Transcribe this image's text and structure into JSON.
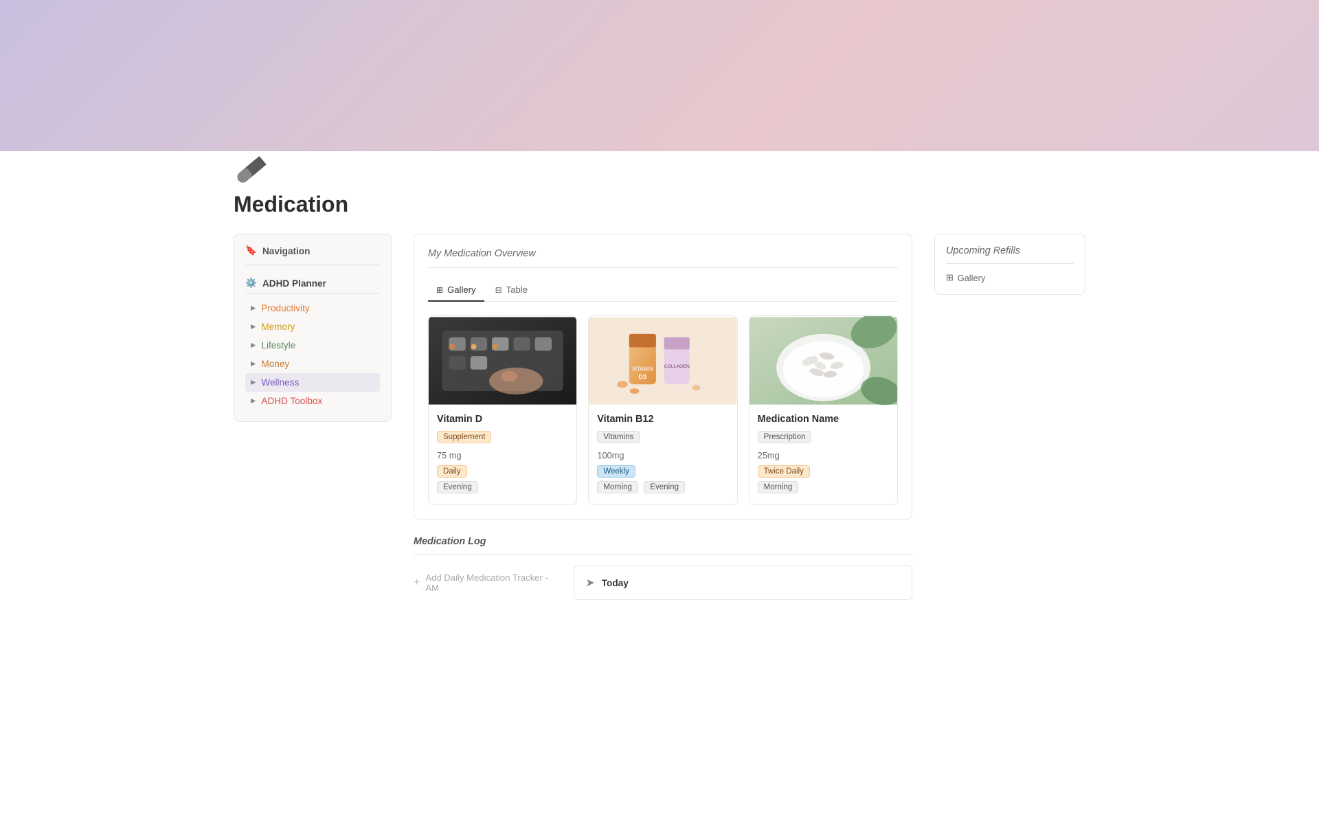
{
  "hero": {
    "alt": "Medication page hero banner"
  },
  "page": {
    "title": "Medication",
    "icon_alt": "pill icon"
  },
  "sidebar": {
    "header_label": "Navigation",
    "adhd_planner_label": "ADHD Planner",
    "items": [
      {
        "id": "productivity",
        "label": "Productivity",
        "color": "productivity",
        "active": false
      },
      {
        "id": "memory",
        "label": "Memory",
        "color": "memory",
        "active": false
      },
      {
        "id": "lifestyle",
        "label": "Lifestyle",
        "color": "lifestyle",
        "active": false
      },
      {
        "id": "money",
        "label": "Money",
        "color": "money",
        "active": false
      },
      {
        "id": "wellness",
        "label": "Wellness",
        "color": "wellness",
        "active": true
      },
      {
        "id": "adhd-toolbox",
        "label": "ADHD Toolbox",
        "color": "adhd-toolbox",
        "active": false
      }
    ]
  },
  "medication_overview": {
    "section_title": "My Medication Overview",
    "tabs": [
      {
        "id": "gallery",
        "label": "Gallery",
        "active": true
      },
      {
        "id": "table",
        "label": "Table",
        "active": false
      }
    ],
    "cards": [
      {
        "name": "Vitamin D",
        "tags": [
          "Supplement"
        ],
        "dosage": "75 mg",
        "schedule_tags": [
          "Daily"
        ],
        "time_tags": [
          "Evening"
        ],
        "image_type": "vitd"
      },
      {
        "name": "Vitamin B12",
        "tags": [
          "Vitamins"
        ],
        "dosage": "100mg",
        "schedule_tags": [
          "Weekly"
        ],
        "time_tags": [
          "Morning",
          "Evening"
        ],
        "image_type": "vitb12"
      },
      {
        "name": "Medication Name",
        "tags": [
          "Prescription"
        ],
        "dosage": "25mg",
        "schedule_tags": [
          "Twice Daily"
        ],
        "time_tags": [
          "Morning"
        ],
        "image_type": "medname"
      }
    ]
  },
  "upcoming_refills": {
    "section_title": "Upcoming Refills",
    "gallery_label": "Gallery"
  },
  "medication_log": {
    "section_title": "Medication Log",
    "add_tracker_label": "Add Daily Medication Tracker - AM",
    "today_label": "Today"
  }
}
